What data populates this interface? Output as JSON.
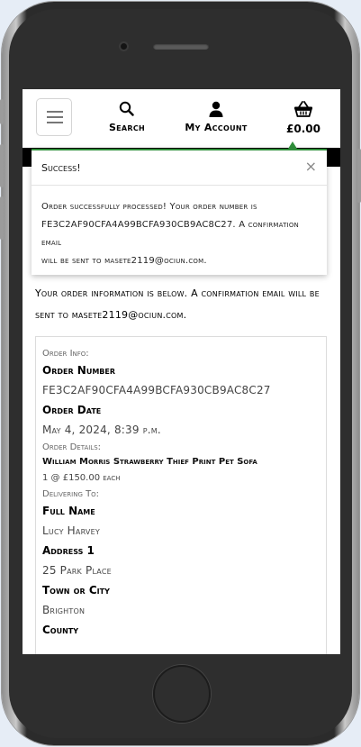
{
  "nav": {
    "search_label": "Search",
    "account_label": "My Account",
    "bag_total": "£0.00"
  },
  "toast": {
    "title": "Success!",
    "close": "×",
    "message_line1": "Order successfully processed! Your order number is",
    "message_line2": "FE3C2AF90CFA4A99BCFA930CB9AC8C27. A confirmation email",
    "message_line3": "will be sent to masete2119@ociun.com."
  },
  "intro": {
    "line1": "Your order information is below. A confirmation email will be",
    "line2": "sent to masete2119@ociun.com."
  },
  "order": {
    "info_heading": "Order Info:",
    "number_label": "Order Number",
    "number_value": "FE3C2AF90CFA4A99BCFA930CB9AC8C27",
    "date_label": "Order Date",
    "date_value": "May 4, 2024, 8:39 p.m.",
    "details_heading": "Order Details:",
    "item_name": "William Morris Strawberry Thief Print Pet Sofa",
    "item_qty": "1 @ £150.00 each",
    "delivery_heading": "Delivering To:",
    "full_name_label": "Full Name",
    "full_name_value": "Lucy Harvey",
    "address1_label": "Address 1",
    "address1_value": "25 Park Place",
    "town_label": "Town or City",
    "town_value": "Brighton",
    "county_label": "County"
  },
  "colors": {
    "success": "#2f8f3a",
    "phone_body": "#2e2e2e",
    "page_bg": "#e6edf6"
  },
  "icons": [
    "hamburger-icon",
    "search-icon",
    "user-icon",
    "shopping-basket-icon",
    "close-icon"
  ]
}
